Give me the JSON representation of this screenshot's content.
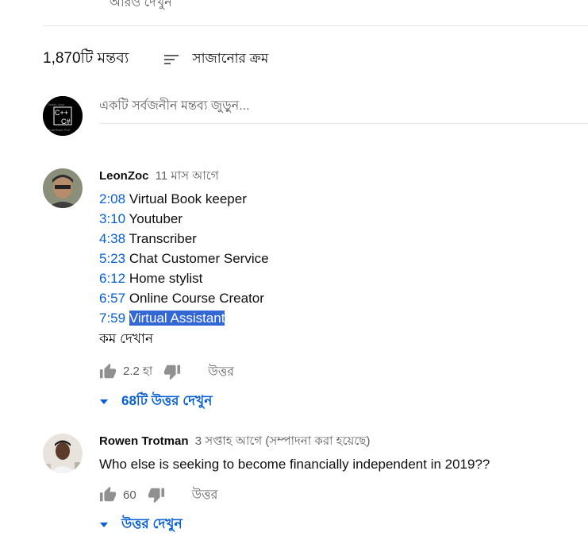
{
  "top_cut_text": "আরও দেখুন",
  "header": {
    "comment_count": "1,870টি মন্তব্য",
    "sort_label": "সাজানোর ক্রম",
    "sort_icon": "sort-icon"
  },
  "add_comment": {
    "placeholder": "একটি সর্বজনীন মন্তব্য জুড়ুন...",
    "avatar_text": "C++ C#"
  },
  "comments": [
    {
      "author": "LeonZoc",
      "time": "11 মাস আগে",
      "timestamps": [
        {
          "ts": "2:08",
          "label": "Virtual Book keeper"
        },
        {
          "ts": "3:10",
          "label": "Youtuber"
        },
        {
          "ts": "4:38",
          "label": "Transcriber"
        },
        {
          "ts": "5:23",
          "label": "Chat Customer Service"
        },
        {
          "ts": "6:12",
          "label": "Home stylist"
        },
        {
          "ts": "6:57",
          "label": "Online Course Creator"
        },
        {
          "ts": "7:59",
          "label": "Virtual Assistant"
        }
      ],
      "show_less": "কম দেখান",
      "likes": "2.2 হা",
      "reply": "উত্তর",
      "view_replies": "68টি উত্তর দেখুন"
    },
    {
      "author": "Rowen Trotman",
      "time": "3 সপ্তাহ আগে (সম্পাদনা করা হয়েছে)",
      "text": "Who else is seeking to become financially independent in 2019??",
      "likes": "60",
      "reply": "উত্তর",
      "view_replies": "উত্তর দেখুন"
    }
  ],
  "colors": {
    "link_blue": "#065fd4",
    "selection": "#3367d6",
    "secondary_text": "#606060",
    "divider": "#e5e5e5"
  }
}
